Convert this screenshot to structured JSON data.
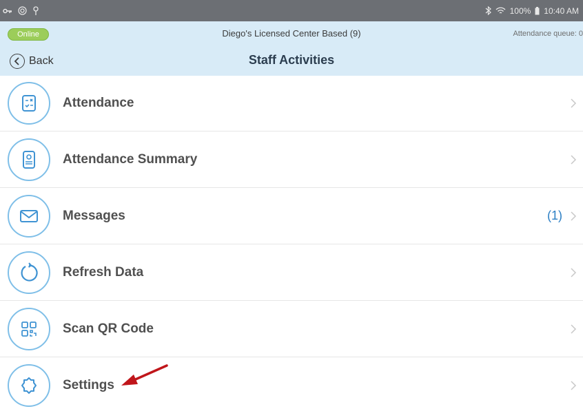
{
  "status_bar": {
    "left_icons": [
      "key-icon",
      "target-icon",
      "location-icon"
    ],
    "right_icons": [
      "bluetooth-icon",
      "wifi-icon",
      "battery-icon"
    ],
    "battery": "100%",
    "time": "10:40 AM"
  },
  "header": {
    "status_pill": "Online",
    "center_name": "Diego's Licensed Center Based (9)",
    "attendance_queue": "Attendance queue: 0",
    "back_label": "Back",
    "title": "Staff Activities"
  },
  "menu": {
    "items": [
      {
        "label": "Attendance",
        "icon": "attendance-icon",
        "badge": ""
      },
      {
        "label": "Attendance Summary",
        "icon": "attendance-summary-icon",
        "badge": ""
      },
      {
        "label": "Messages",
        "icon": "envelope-icon",
        "badge": "(1)"
      },
      {
        "label": "Refresh Data",
        "icon": "refresh-icon",
        "badge": ""
      },
      {
        "label": "Scan QR Code",
        "icon": "qr-code-icon",
        "badge": ""
      },
      {
        "label": "Settings",
        "icon": "gear-icon",
        "badge": ""
      }
    ]
  },
  "colors": {
    "header_bg": "#d8ebf7",
    "online": "#9ccd5a",
    "icon_ring": "#7fbfe8",
    "badge": "#2c7fc4",
    "annotation_arrow": "#c0161b"
  }
}
